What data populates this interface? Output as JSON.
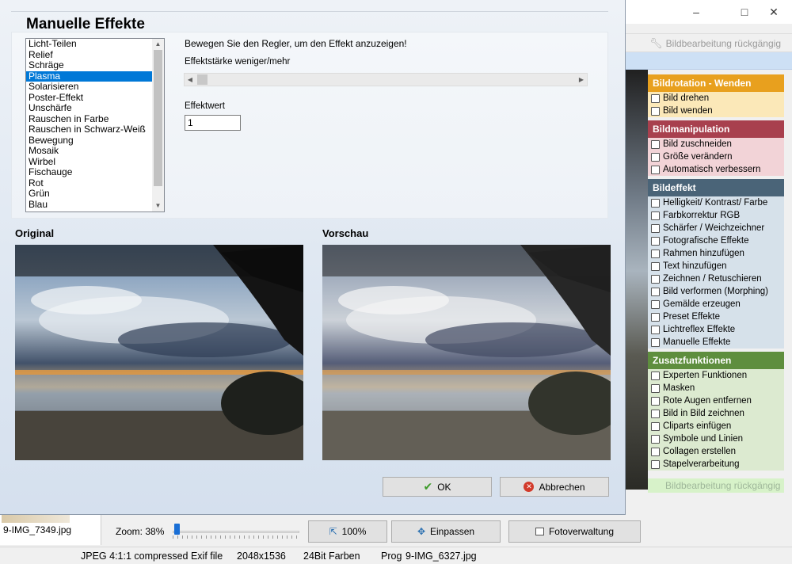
{
  "main": {
    "toolbar_undo": "Bildbearbeitung rückgängig",
    "sidebar": [
      {
        "title": "Bildrotation - Wenden",
        "color": "#e8a01e",
        "bg": "#fbe8b8",
        "items": [
          {
            "label": "Bild drehen",
            "icon": "rotate-image-icon"
          },
          {
            "label": "Bild wenden",
            "icon": "flip-image-icon"
          }
        ]
      },
      {
        "title": "Bildmanipulation",
        "color": "#a8404e",
        "bg": "#f2d3d7",
        "items": [
          {
            "label": "Bild zuschneiden",
            "icon": "crop-icon"
          },
          {
            "label": "Größe verändern",
            "icon": "resize-icon"
          },
          {
            "label": "Automatisch verbessern",
            "icon": "auto-enhance-icon"
          }
        ]
      },
      {
        "title": "Bildeffekt",
        "color": "#4a6478",
        "bg": "#d6e1ea",
        "items": [
          {
            "label": "Helligkeit/ Kontrast/ Farbe",
            "icon": "brightness-icon"
          },
          {
            "label": "Farbkorrektur RGB",
            "icon": "rgb-icon"
          },
          {
            "label": "Schärfer / Weichzeichner",
            "icon": "sharpen-icon"
          },
          {
            "label": "Fotografische Effekte",
            "icon": "camera-icon"
          },
          {
            "label": "Rahmen hinzufügen",
            "icon": "frame-icon"
          },
          {
            "label": "Text hinzufügen",
            "icon": "text-icon"
          },
          {
            "label": "Zeichnen / Retuschieren",
            "icon": "brush-icon"
          },
          {
            "label": "Bild verformen (Morphing)",
            "icon": "morph-icon"
          },
          {
            "label": "Gemälde erzeugen",
            "icon": "painting-icon"
          },
          {
            "label": "Preset Effekte",
            "icon": "preset-icon"
          },
          {
            "label": "Lichtreflex Effekte",
            "icon": "light-flare-icon"
          },
          {
            "label": "Manuelle Effekte",
            "icon": "manual-effects-icon"
          }
        ]
      },
      {
        "title": "Zusatzfunktionen",
        "color": "#5e8e3e",
        "bg": "#dcead0",
        "items": [
          {
            "label": "Experten Funktionen",
            "icon": "expert-icon"
          },
          {
            "label": "Masken",
            "icon": "mask-icon"
          },
          {
            "label": "Rote Augen entfernen",
            "icon": "red-eye-icon"
          },
          {
            "label": "Bild in Bild zeichnen",
            "icon": "picture-in-picture-icon"
          },
          {
            "label": "Cliparts einfügen",
            "icon": "clipart-icon"
          },
          {
            "label": "Symbole und Linien",
            "icon": "symbols-icon"
          },
          {
            "label": "Collagen erstellen",
            "icon": "collage-icon"
          },
          {
            "label": "Stapelverarbeitung",
            "icon": "batch-icon"
          }
        ]
      }
    ],
    "sidebar_undo": "Bildbearbeitung rückgängig",
    "thumbnail_label": "9-IMG_7349.jpg",
    "zoom_label": "Zoom: 38%",
    "zoom_value": 0.38,
    "btn_100": "100%",
    "btn_fit": "Einpassen",
    "btn_photo_manager": "Fotoverwaltung",
    "status": {
      "format": "JPEG 4:1:1 compressed Exif file",
      "size": "2048x1536",
      "depth": "24Bit Farben",
      "prog": "Prog",
      "file": "9-IMG_6327.jpg"
    }
  },
  "dialog": {
    "title": "Manuelle Effekte",
    "effects": [
      "Licht-Teilen",
      "Relief",
      "Schräge",
      "Plasma",
      "Solarisieren",
      "Poster-Effekt",
      "Unschärfe",
      "Rauschen in Farbe",
      "Rauschen in Schwarz-Weiß",
      "Bewegung",
      "Mosaik",
      "Wirbel",
      "Fischauge",
      "Rot",
      "Grün",
      "Blau"
    ],
    "selected_index": 3,
    "instruction": "Bewegen Sie den Regler, um den Effekt anzuzeigen!",
    "strength_label": "Effektstärke weniger/mehr",
    "strength_value": 0.0,
    "value_label": "Effektwert",
    "value": "1",
    "original_label": "Original",
    "preview_label": "Vorschau",
    "ok_label": "OK",
    "cancel_label": "Abbrechen"
  }
}
